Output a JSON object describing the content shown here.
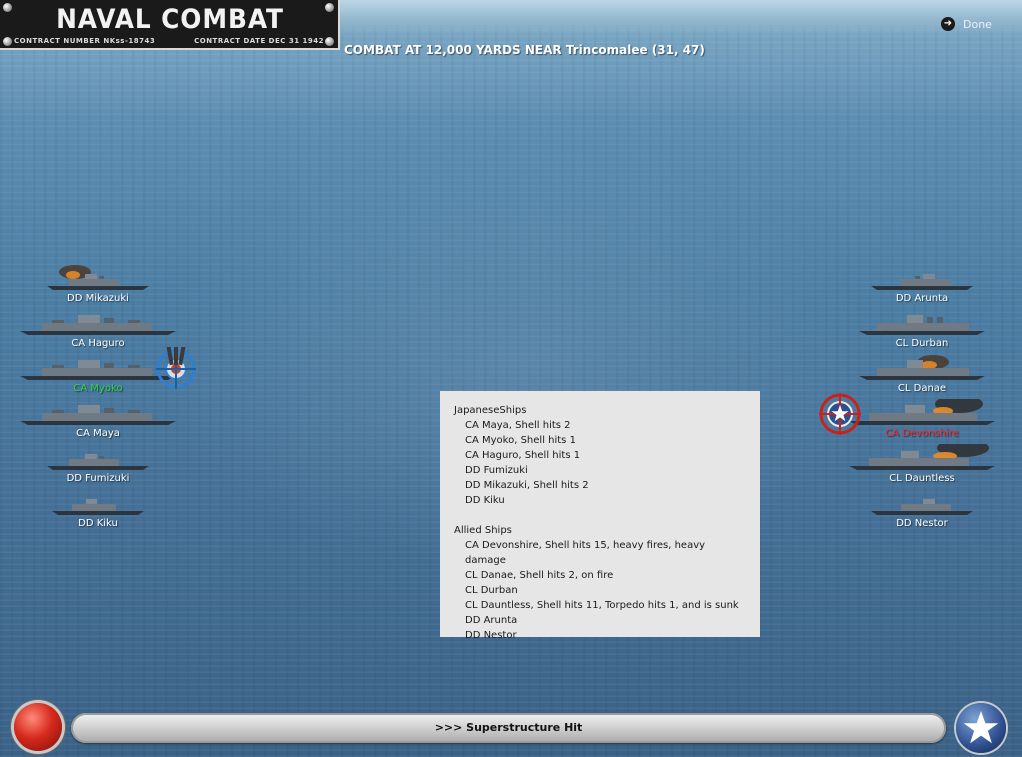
{
  "header": {
    "title": "NAVAL COMBAT",
    "contract_number": "CONTRACT NUMBER NKss-18743",
    "contract_date": "CONTRACT DATE DEC 31 1942",
    "combat_location": "COMBAT AT 12,000 YARDS NEAR Trincomalee (31, 47)",
    "done_label": "Done"
  },
  "japanese_fleet": [
    {
      "label": "DD Mikazuki",
      "state": "burning"
    },
    {
      "label": "CA Haguro",
      "state": "normal"
    },
    {
      "label": "CA Myoko",
      "state": "firing"
    },
    {
      "label": "CA Maya",
      "state": "normal"
    },
    {
      "label": "DD Fumizuki",
      "state": "normal"
    },
    {
      "label": "DD Kiku",
      "state": "normal"
    }
  ],
  "allied_fleet": [
    {
      "label": "DD Arunta",
      "state": "normal"
    },
    {
      "label": "CL Durban",
      "state": "normal"
    },
    {
      "label": "CL Danae",
      "state": "burning"
    },
    {
      "label": "CA Devonshire",
      "state": "targeted"
    },
    {
      "label": "CL Dauntless",
      "state": "burning"
    },
    {
      "label": "DD Nestor",
      "state": "normal"
    }
  ],
  "report": {
    "japanese_header": "JapaneseShips",
    "japanese": [
      "CA Maya, Shell hits 2",
      "CA Myoko, Shell hits 1",
      "CA Haguro, Shell hits 1",
      "DD Fumizuki",
      "DD Mikazuki, Shell hits 2",
      "DD Kiku"
    ],
    "allied_header": "Allied Ships",
    "allied": [
      "CA Devonshire, Shell hits 15,  heavy fires,  heavy damage",
      "CL Danae, Shell hits 2,  on fire",
      "CL Durban",
      "CL Dauntless, Shell hits 11, Torpedo hits 1, and is sunk",
      "DD Arunta",
      "DD Nestor"
    ]
  },
  "status": {
    "message": ">>> Superstructure Hit"
  },
  "colors": {
    "active_label": "#34d44a",
    "targeted_label": "#ff2a2a",
    "report_bg": "#e6e6e6"
  }
}
